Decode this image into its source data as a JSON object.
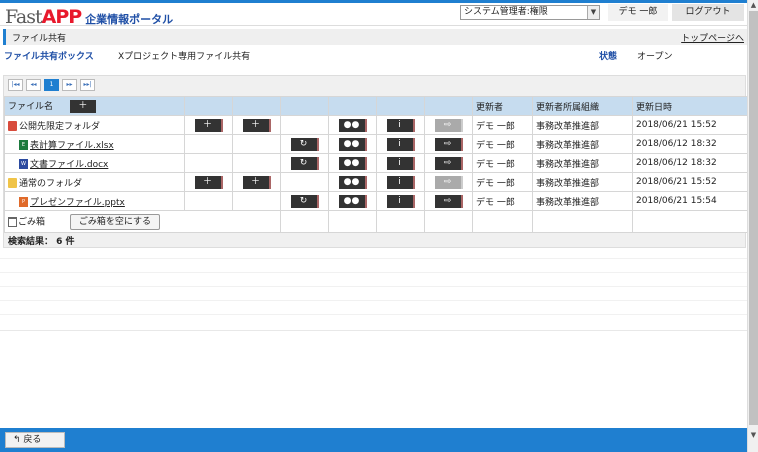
{
  "header": {
    "logo_fast": "Fast",
    "logo_app": "APP",
    "logo_portal": "企業情報ポータル",
    "role_select": "システム管理者:権限",
    "user_name": "デモ 一郎",
    "logout_label": "ログアウト"
  },
  "titlebar": {
    "title": "ファイル共有",
    "top_link": "トップページへ"
  },
  "info": {
    "box_label": "ファイル共有ボックス",
    "box_value": "Xプロジェクト専用ファイル共有",
    "status_label": "状態",
    "status_value": "オープン"
  },
  "pager": {
    "first": "|◂◂",
    "prev": "◂◂",
    "current": "1",
    "next": "▸▸",
    "last": "▸▸|"
  },
  "table": {
    "columns": {
      "name": "ファイル名",
      "updater": "更新者",
      "org": "更新者所属組織",
      "date": "更新日時"
    },
    "rows": [
      {
        "name": "公開先限定フォルダ",
        "updater": "デモ 一郎",
        "org": "事務改革推進部",
        "date": "2018/06/21 15:52"
      },
      {
        "name": "表計算ファイル.xlsx",
        "updater": "デモ 一郎",
        "org": "事務改革推進部",
        "date": "2018/06/12 18:32"
      },
      {
        "name": "文書ファイル.docx",
        "updater": "デモ 一郎",
        "org": "事務改革推進部",
        "date": "2018/06/12 18:32"
      },
      {
        "name": "通常のフォルダ",
        "updater": "デモ 一郎",
        "org": "事務改革推進部",
        "date": "2018/06/21 15:52"
      },
      {
        "name": "プレゼンファイル.pptx",
        "updater": "デモ 一郎",
        "org": "事務改革推進部",
        "date": "2018/06/21 15:54"
      }
    ],
    "trash_label": "ごみ箱",
    "empty_trash_label": "ごみ箱を空にする"
  },
  "result_text": "検索結果： 6 件",
  "footer": {
    "back_label": "戻る"
  },
  "colors": {
    "accent": "#1f7fd0",
    "brand_red": "#e8192c",
    "header_blue": "#c6dcef"
  }
}
